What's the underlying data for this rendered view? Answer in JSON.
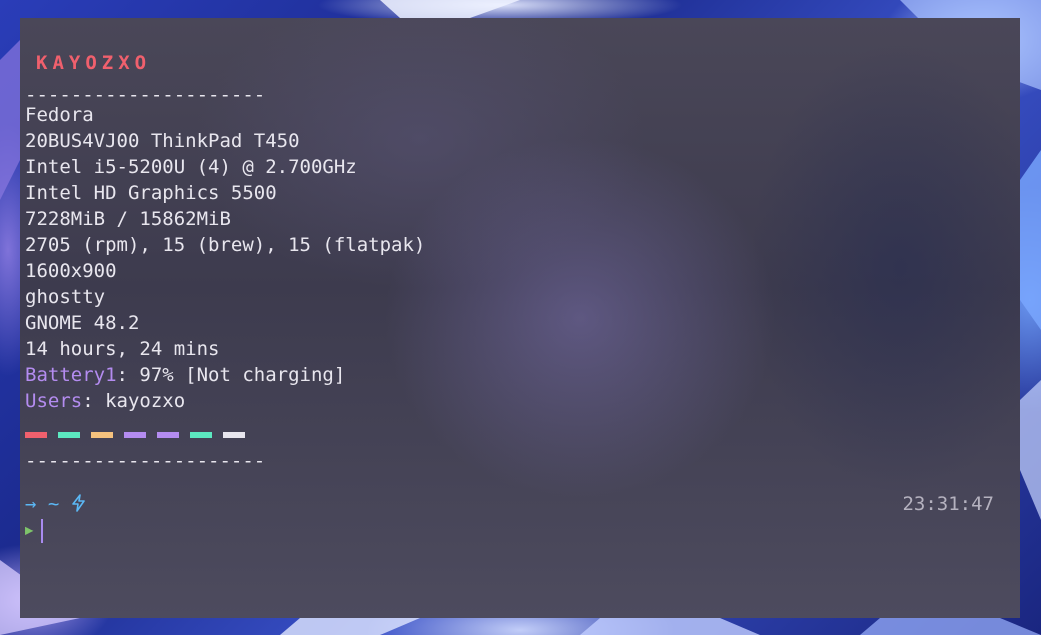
{
  "fetch": {
    "title": "KAYOZXO",
    "separator": "---------------------",
    "os": "Fedora",
    "host": "20BUS4VJ00 ThinkPad T450",
    "cpu": "Intel i5-5200U (4) @ 2.700GHz",
    "gpu": "Intel HD Graphics 5500",
    "memory": "7228MiB / 15862MiB",
    "packages": "2705 (rpm), 15 (brew), 15 (flatpak)",
    "resolution": "1600x900",
    "terminal": "ghostty",
    "de": "GNOME 48.2",
    "uptime": "14 hours, 24 mins",
    "battery_key": "Battery1",
    "battery_value": ": 97% [Not charging]",
    "users_key": "Users",
    "users_value": ": kayozxo",
    "palette": [
      "#f0606d",
      "#5ce8c0",
      "#f5c27e",
      "#b48cf0",
      "#b48cf0",
      "#5ce8c0",
      "#e8e6ee"
    ]
  },
  "prompt": {
    "arrow": "→",
    "dir": "~",
    "icon": "lightning-icon",
    "time": "23:31:47",
    "input_symbol": "▶"
  },
  "colors": {
    "accent_red": "#f0606d",
    "accent_purple": "#b48cf0",
    "prompt_blue": "#5bb8f5",
    "prompt_green": "#7ec46a"
  }
}
